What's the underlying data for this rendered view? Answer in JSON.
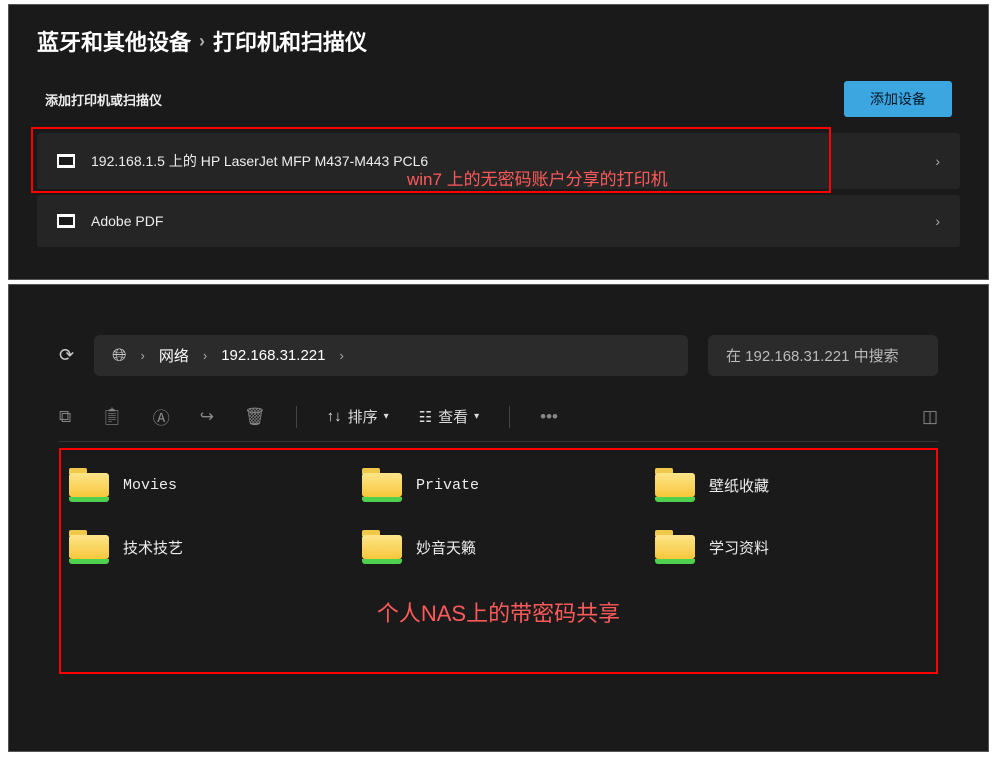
{
  "top": {
    "breadcrumb": {
      "parent": "蓝牙和其他设备",
      "current": "打印机和扫描仪"
    },
    "subheader": "添加打印机或扫描仪",
    "add_btn": "添加设备",
    "devices": [
      {
        "name": "192.168.1.5 上的 HP LaserJet MFP M437-M443 PCL6"
      },
      {
        "name": "Adobe PDF"
      }
    ],
    "annotation": "win7 上的无密码账户分享的打印机"
  },
  "bottom": {
    "path": {
      "seg1": "网络",
      "seg2": "192.168.31.221"
    },
    "search_placeholder": "在 192.168.31.221 中搜索",
    "toolbar": {
      "sort": "排序",
      "view": "查看"
    },
    "folders": [
      {
        "label": "Movies"
      },
      {
        "label": "Private"
      },
      {
        "label": "壁纸收藏"
      },
      {
        "label": "技术技艺"
      },
      {
        "label": "妙音天籁"
      },
      {
        "label": "学习资料"
      }
    ],
    "annotation": "个人NAS上的带密码共享"
  }
}
